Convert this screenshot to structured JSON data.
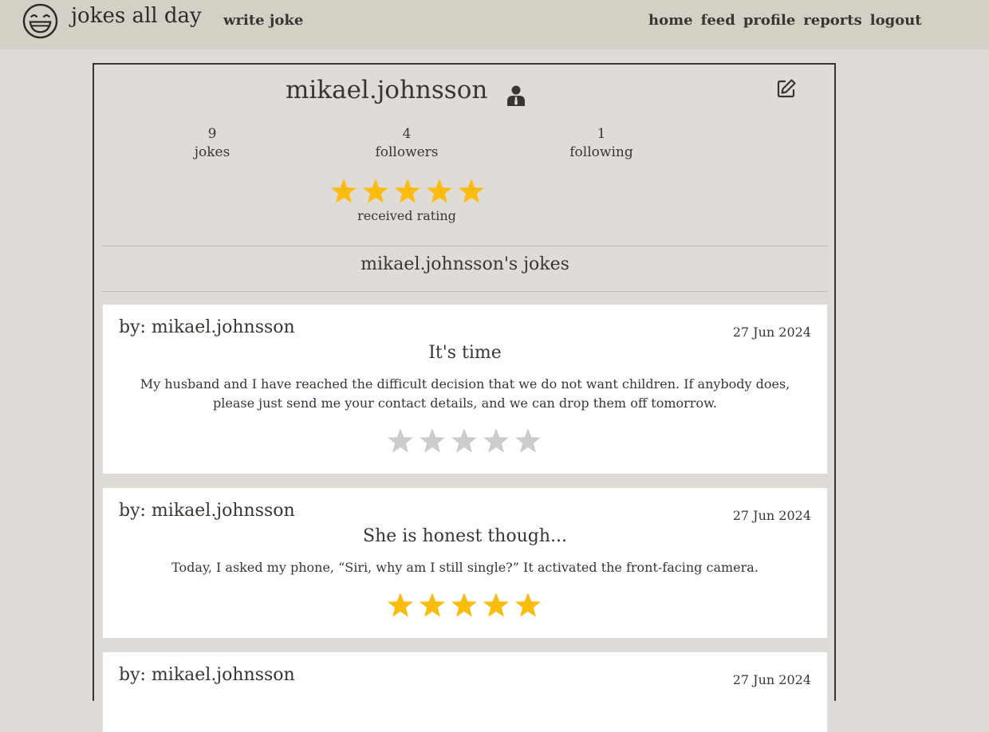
{
  "header": {
    "brand": "jokes all day",
    "write_joke": "write joke",
    "nav": [
      "home",
      "feed",
      "profile",
      "reports",
      "logout"
    ]
  },
  "profile": {
    "username": "mikael.johnsson",
    "stats": [
      {
        "value": "9",
        "label": "jokes"
      },
      {
        "value": "4",
        "followers_label": "",
        "label": "followers"
      },
      {
        "value": "1",
        "label": "following"
      }
    ],
    "received_rating": 5,
    "received_rating_max": 5,
    "received_rating_label": "received rating"
  },
  "jokes_section_title": "mikael.johnsson's jokes",
  "jokes": [
    {
      "author": "by: mikael.johnsson",
      "date": "27 Jun 2024",
      "title": "It's time",
      "body": "My husband and I have reached the difficult decision that we do not want children. If anybody does, please just send me your contact details, and we can drop them off tomorrow.",
      "rating": 0
    },
    {
      "author": "by: mikael.johnsson",
      "date": "27 Jun 2024",
      "title": "She is honest though...",
      "body": "Today, I asked my phone, “Siri, why am I still single?” It activated the front-facing camera.",
      "rating": 5
    },
    {
      "author": "by: mikael.johnsson",
      "date": "27 Jun 2024",
      "title": "",
      "body": "",
      "rating": 0
    }
  ],
  "colors": {
    "star_filled": "#fbbc0f",
    "star_empty": "#cccccc",
    "topbar": "#d4d0c6",
    "background": "#dfdcd8"
  },
  "icons": {
    "logo": "laughing-face-icon",
    "user": "user-tie-icon",
    "edit": "edit-icon",
    "star": "star-icon"
  }
}
